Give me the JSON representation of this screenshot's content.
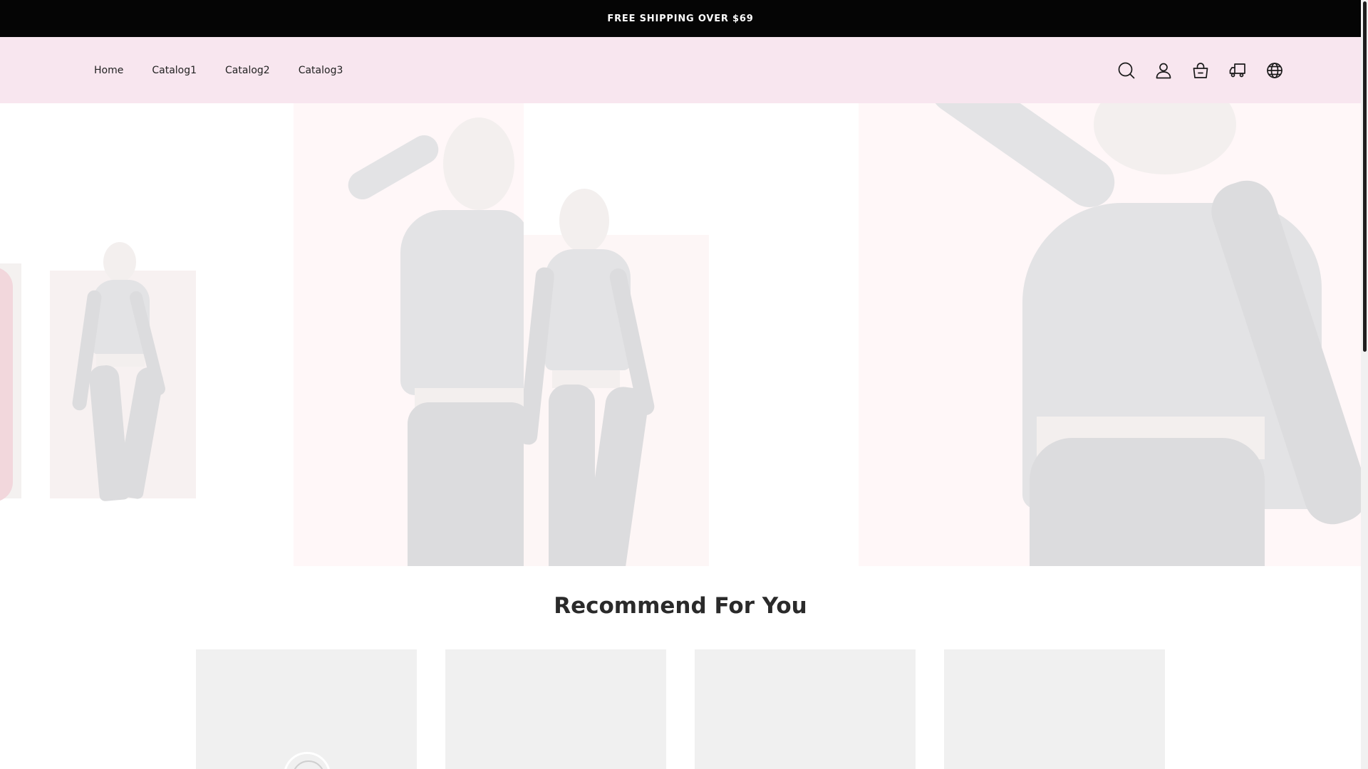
{
  "announcement": {
    "text": "FREE SHIPPING OVER $69"
  },
  "nav": {
    "items": [
      {
        "label": "Home"
      },
      {
        "label": "Catalog1"
      },
      {
        "label": "Catalog2"
      },
      {
        "label": "Catalog3"
      }
    ]
  },
  "header_icons": [
    "search-icon",
    "account-icon",
    "cart-icon",
    "shipping-truck-icon",
    "globe-icon"
  ],
  "section": {
    "title": "Recommend For You"
  },
  "product_cards": 4,
  "colors": {
    "announcement_bg": "#050505",
    "header_bg": "#f8e6ef",
    "card_bg": "#f0f0f0"
  }
}
